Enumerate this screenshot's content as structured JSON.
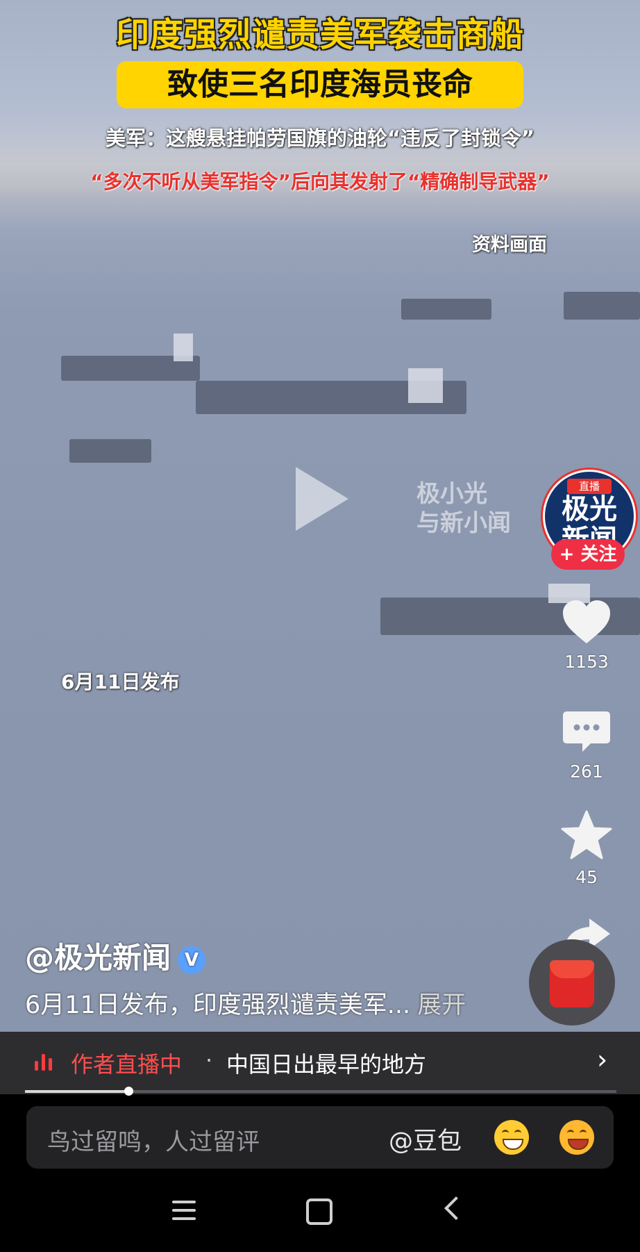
{
  "video": {
    "headline": "印度强烈谴责美军袭击商船",
    "subheadline": "致使三名印度海员丧命",
    "caption_line1": "美军：这艘悬挂帕劳国旗的油轮“违反了封锁令”",
    "caption_line2": "“多次不听从美军指令”后向其发射了“精确制导武器”",
    "source_label": "资料画面",
    "publish_overlay": "6月11日发布",
    "watermark_line1": "极小光",
    "watermark_line2": "与新小闻"
  },
  "author_avatar": {
    "live_badge": "直播",
    "name": "极光新闻",
    "follow_label": "+ 关注"
  },
  "actions": {
    "likes": "1153",
    "comments": "261",
    "favorites": "45",
    "share_label": "享"
  },
  "post": {
    "author": "@极光新闻",
    "verified_mark": "V",
    "description": "6月11日发布，印度强烈谴责美军...",
    "expand_label": "展开"
  },
  "live_bar": {
    "status": "作者直播中",
    "separator": "·",
    "location": "中国日出最早的地方",
    "chevron": "›"
  },
  "progress": {
    "played_fraction": 0.175
  },
  "comment_box": {
    "placeholder": "鸟过留鸣，人过留评",
    "mention": "@豆包"
  },
  "icons": [
    "play-icon",
    "heart-icon",
    "comment-icon",
    "star-icon",
    "share-icon",
    "red-packet-icon",
    "grin-emoji-icon",
    "laugh-cry-emoji-icon",
    "menu-icon",
    "home-icon",
    "back-icon"
  ],
  "colors": {
    "headline": "#ffd400",
    "live_red": "#ff4d4d",
    "follow_red": "#ef2f45"
  }
}
